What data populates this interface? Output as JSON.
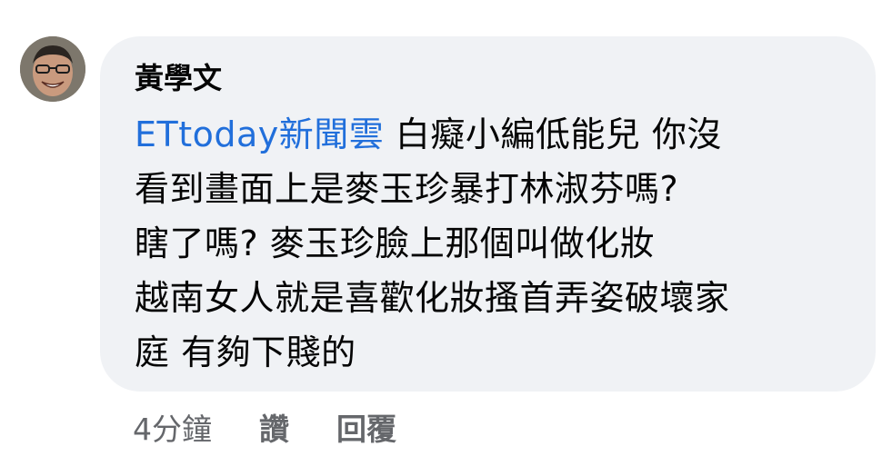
{
  "comment": {
    "author": "黃學文",
    "mention": "ETtoday新聞雲",
    "lines": [
      " 白癡小編低能兒 你沒",
      "看到畫面上是麥玉珍暴打林淑芬嗎?",
      "瞎了嗎? 麥玉珍臉上那個叫做化妝",
      "越南女人就是喜歡化妝搔首弄姿破壞家",
      "庭 有夠下賤的"
    ],
    "time": "4分鐘",
    "like_label": "讚",
    "reply_label": "回覆"
  }
}
